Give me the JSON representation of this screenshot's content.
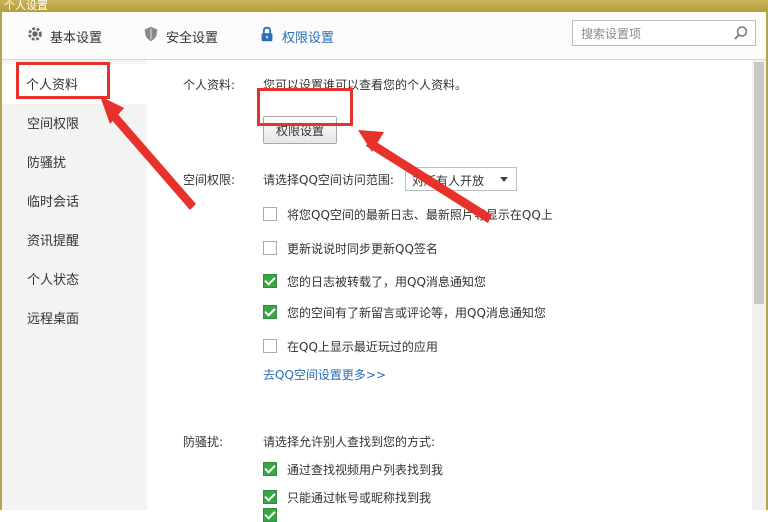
{
  "window": {
    "title": "个人设置"
  },
  "tabs": [
    {
      "label": "基本设置",
      "icon": "gear-icon"
    },
    {
      "label": "安全设置",
      "icon": "shield-icon"
    },
    {
      "label": "权限设置",
      "icon": "lock-icon"
    }
  ],
  "search": {
    "placeholder": "搜索设置项"
  },
  "sidebar": {
    "items": [
      {
        "label": "个人资料"
      },
      {
        "label": "空间权限"
      },
      {
        "label": "防骚扰"
      },
      {
        "label": "临时会话"
      },
      {
        "label": "资讯提醒"
      },
      {
        "label": "个人状态"
      },
      {
        "label": "远程桌面"
      }
    ]
  },
  "profile": {
    "label": "个人资料:",
    "description": "您可以设置谁可以查看您的个人资料。",
    "button_label": "权限设置"
  },
  "space": {
    "label": "空间权限:",
    "range_prompt": "请选择QQ空间访问范围:",
    "range_value": "对所有人开放",
    "options": [
      {
        "text": "将您QQ空间的最新日志、最新照片等显示在QQ上",
        "checked": false
      },
      {
        "text": "更新说说时同步更新QQ签名",
        "checked": false
      },
      {
        "text": "您的日志被转载了，用QQ消息通知您",
        "checked": true
      },
      {
        "text": "您的空间有了新留言或评论等，用QQ消息通知您",
        "checked": true
      },
      {
        "text": "在QQ上显示最近玩过的应用",
        "checked": false
      }
    ],
    "more_link": "去QQ空间设置更多>>"
  },
  "antispam": {
    "label": "防骚扰:",
    "prompt": "请选择允许别人查找到您的方式:",
    "options": [
      {
        "text": "通过查找视频用户列表找到我",
        "checked": true
      },
      {
        "text": "只能通过帐号或昵称找到我",
        "checked": true
      }
    ]
  },
  "colors": {
    "accent": "#2a6fb8",
    "highlight_red": "#e8312b",
    "check_green": "#3aa545"
  }
}
